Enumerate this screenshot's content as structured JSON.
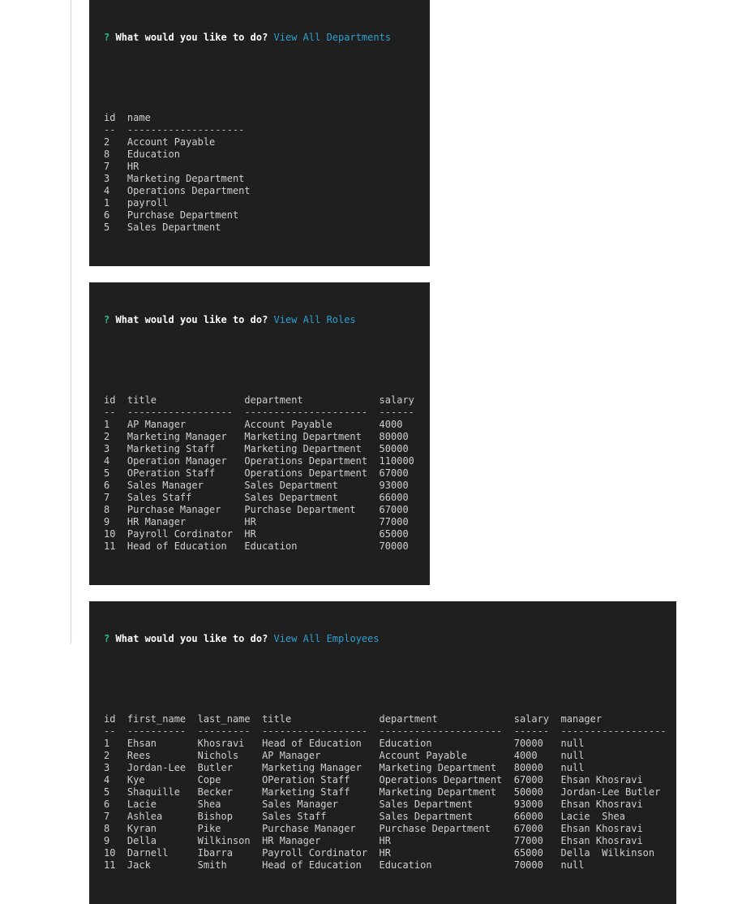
{
  "page": {
    "background": "#ffffff",
    "rule_color": "#ccd6dd",
    "terminal_background": "#1e1f1e",
    "terminal_text_color": "#cfcfcf",
    "prompt_mark_color": "#2bbc8a",
    "prompt_question_color": "#ffffff",
    "prompt_answer_color": "#2f9fd0"
  },
  "blocks": {
    "departments": {
      "prompt": {
        "mark": "?",
        "question": "What would you like to do?",
        "answer": "View All Departments"
      },
      "columns": [
        "id",
        "name"
      ],
      "rule": "--  --------------------",
      "header_line": "id  name",
      "rows": [
        {
          "id": "2",
          "name": "Account Payable"
        },
        {
          "id": "8",
          "name": "Education"
        },
        {
          "id": "7",
          "name": "HR"
        },
        {
          "id": "3",
          "name": "Marketing Department"
        },
        {
          "id": "4",
          "name": "Operations Department"
        },
        {
          "id": "1",
          "name": "payroll"
        },
        {
          "id": "6",
          "name": "Purchase Department"
        },
        {
          "id": "5",
          "name": "Sales Department"
        }
      ],
      "lines": [
        "id  name",
        "--  --------------------",
        "2   Account Payable",
        "8   Education",
        "7   HR",
        "3   Marketing Department",
        "4   Operations Department",
        "1   payroll",
        "6   Purchase Department",
        "5   Sales Department"
      ]
    },
    "roles": {
      "prompt": {
        "mark": "?",
        "question": "What would you like to do?",
        "answer": "View All Roles"
      },
      "columns": [
        "id",
        "title",
        "department",
        "salary"
      ],
      "rows": [
        {
          "id": "1",
          "title": "AP Manager",
          "department": "Account Payable",
          "salary": "4000"
        },
        {
          "id": "2",
          "title": "Marketing Manager",
          "department": "Marketing Department",
          "salary": "80000"
        },
        {
          "id": "3",
          "title": "Marketing Staff",
          "department": "Marketing Department",
          "salary": "50000"
        },
        {
          "id": "4",
          "title": "Operation Manager",
          "department": "Operations Department",
          "salary": "110000"
        },
        {
          "id": "5",
          "title": "OPeration Staff",
          "department": "Operations Department",
          "salary": "67000"
        },
        {
          "id": "6",
          "title": "Sales Manager",
          "department": "Sales Department",
          "salary": "93000"
        },
        {
          "id": "7",
          "title": "Sales Staff",
          "department": "Sales Department",
          "salary": "66000"
        },
        {
          "id": "8",
          "title": "Purchase Manager",
          "department": "Purchase Department",
          "salary": "67000"
        },
        {
          "id": "9",
          "title": "HR Manager",
          "department": "HR",
          "salary": "77000"
        },
        {
          "id": "10",
          "title": "Payroll Cordinator",
          "department": "HR",
          "salary": "65000"
        },
        {
          "id": "11",
          "title": "Head of Education",
          "department": "Education",
          "salary": "70000"
        }
      ],
      "lines": [
        "id  title               department             salary",
        "--  ------------------  ---------------------  ------",
        "1   AP Manager          Account Payable        4000",
        "2   Marketing Manager   Marketing Department   80000",
        "3   Marketing Staff     Marketing Department   50000",
        "4   Operation Manager   Operations Department  110000",
        "5   OPeration Staff     Operations Department  67000",
        "6   Sales Manager       Sales Department       93000",
        "7   Sales Staff         Sales Department       66000",
        "8   Purchase Manager    Purchase Department    67000",
        "9   HR Manager          HR                     77000",
        "10  Payroll Cordinator  HR                     65000",
        "11  Head of Education   Education              70000"
      ]
    },
    "employees": {
      "prompt": {
        "mark": "?",
        "question": "What would you like to do?",
        "answer": "View All Employees"
      },
      "columns": [
        "id",
        "first_name",
        "last_name",
        "title",
        "department",
        "salary",
        "manager"
      ],
      "rows": [
        {
          "id": "1",
          "first_name": "Ehsan",
          "last_name": "Khosravi",
          "title": "Head of Education",
          "department": "Education",
          "salary": "70000",
          "manager": "null"
        },
        {
          "id": "2",
          "first_name": "Rees",
          "last_name": "Nichols",
          "title": "AP Manager",
          "department": "Account Payable",
          "salary": "4000",
          "manager": "null"
        },
        {
          "id": "3",
          "first_name": "Jordan-Lee",
          "last_name": "Butler",
          "title": "Marketing Manager",
          "department": "Marketing Department",
          "salary": "80000",
          "manager": "null"
        },
        {
          "id": "4",
          "first_name": "Kye",
          "last_name": "Cope",
          "title": "OPeration Staff",
          "department": "Operations Department",
          "salary": "67000",
          "manager": "Ehsan Khosravi"
        },
        {
          "id": "5",
          "first_name": "Shaquille",
          "last_name": "Becker",
          "title": "Marketing Staff",
          "department": "Marketing Department",
          "salary": "50000",
          "manager": "Jordan-Lee Butler"
        },
        {
          "id": "6",
          "first_name": "Lacie",
          "last_name": "Shea",
          "title": "Sales Manager",
          "department": "Sales Department",
          "salary": "93000",
          "manager": "Ehsan Khosravi"
        },
        {
          "id": "7",
          "first_name": "Ashlea",
          "last_name": "Bishop",
          "title": "Sales Staff",
          "department": "Sales Department",
          "salary": "66000",
          "manager": "Lacie  Shea"
        },
        {
          "id": "8",
          "first_name": "Kyran",
          "last_name": "Pike",
          "title": "Purchase Manager",
          "department": "Purchase Department",
          "salary": "67000",
          "manager": "Ehsan Khosravi"
        },
        {
          "id": "9",
          "first_name": "Della",
          "last_name": "Wilkinson",
          "title": "HR Manager",
          "department": "HR",
          "salary": "77000",
          "manager": "Ehsan Khosravi"
        },
        {
          "id": "10",
          "first_name": "Darnell",
          "last_name": "Ibarra",
          "title": "Payroll Cordinator",
          "department": "HR",
          "salary": "65000",
          "manager": "Della  Wilkinson"
        },
        {
          "id": "11",
          "first_name": "Jack",
          "last_name": "Smith",
          "title": "Head of Education",
          "department": "Education",
          "salary": "70000",
          "manager": "null"
        }
      ],
      "lines": [
        "id  first_name  last_name  title               department             salary  manager",
        "--  ----------  ---------  ------------------  ---------------------  ------  ------------------",
        "1   Ehsan       Khosravi   Head of Education   Education              70000   null",
        "2   Rees        Nichols    AP Manager          Account Payable        4000    null",
        "3   Jordan-Lee  Butler     Marketing Manager   Marketing Department   80000   null",
        "4   Kye         Cope       OPeration Staff     Operations Department  67000   Ehsan Khosravi",
        "5   Shaquille   Becker     Marketing Staff     Marketing Department   50000   Jordan-Lee Butler",
        "6   Lacie       Shea       Sales Manager       Sales Department       93000   Ehsan Khosravi",
        "7   Ashlea      Bishop     Sales Staff         Sales Department       66000   Lacie  Shea",
        "8   Kyran       Pike       Purchase Manager    Purchase Department    67000   Ehsan Khosravi",
        "9   Della       Wilkinson  HR Manager          HR                     77000   Ehsan Khosravi",
        "10  Darnell     Ibarra     Payroll Cordinator  HR                     65000   Della  Wilkinson",
        "11  Jack        Smith      Head of Education   Education              70000   null"
      ]
    }
  }
}
